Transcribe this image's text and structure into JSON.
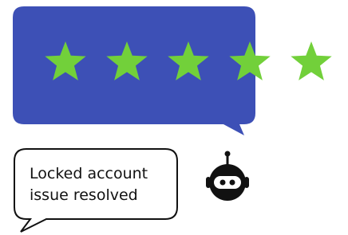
{
  "rating": {
    "value": 5,
    "max": 5,
    "star_color": "#72d03a"
  },
  "review_bubble": {
    "color": "#3d50b6"
  },
  "message": {
    "line1": "Locked account",
    "line2": "issue resolved"
  },
  "bot": {
    "icon": "robot-icon",
    "color": "#111111"
  }
}
